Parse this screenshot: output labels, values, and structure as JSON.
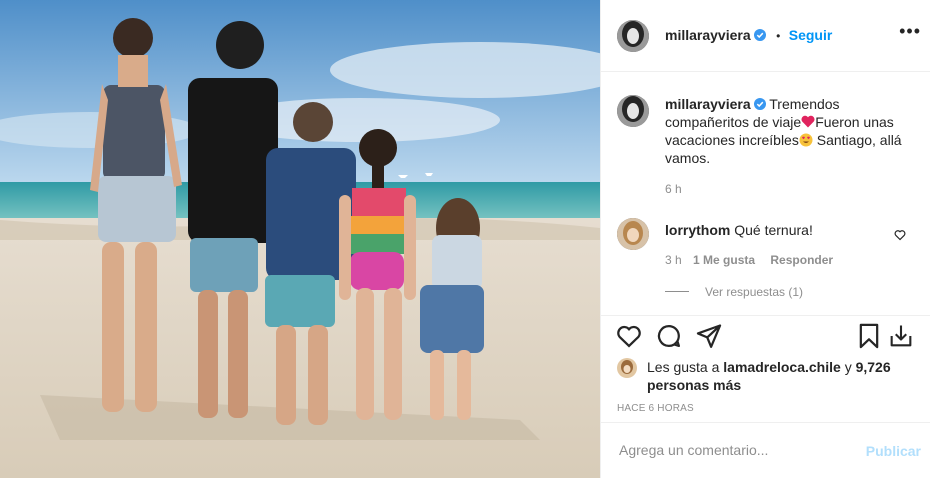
{
  "header": {
    "username": "millarayviera",
    "follow_label": "Seguir",
    "dot": "•",
    "more_label": "•••"
  },
  "caption": {
    "username": "millarayviera",
    "text_1": "Tremendos compañeritos de viaje",
    "text_2": "Fueron unas vacaciones increíbles",
    "text_3": " Santiago, allá vamos.",
    "time": "6 h"
  },
  "comment": {
    "username": "lorrythom",
    "text": "Qué ternura!",
    "time": "3 h",
    "likes": "1 Me gusta",
    "reply_label": "Responder",
    "view_replies": "Ver respuestas (1)"
  },
  "likes": {
    "prefix": "Les gusta a",
    "user": "lamadreloca.chile",
    "connector": "y",
    "others": "9,726 personas más"
  },
  "post_time": "HACE 6 HORAS",
  "add_comment": {
    "placeholder": "Agrega un comentario...",
    "publish_label": "Publicar"
  },
  "colors": {
    "accent": "#0095f6",
    "verified": "#3897f0",
    "heart": "#ed4956"
  }
}
